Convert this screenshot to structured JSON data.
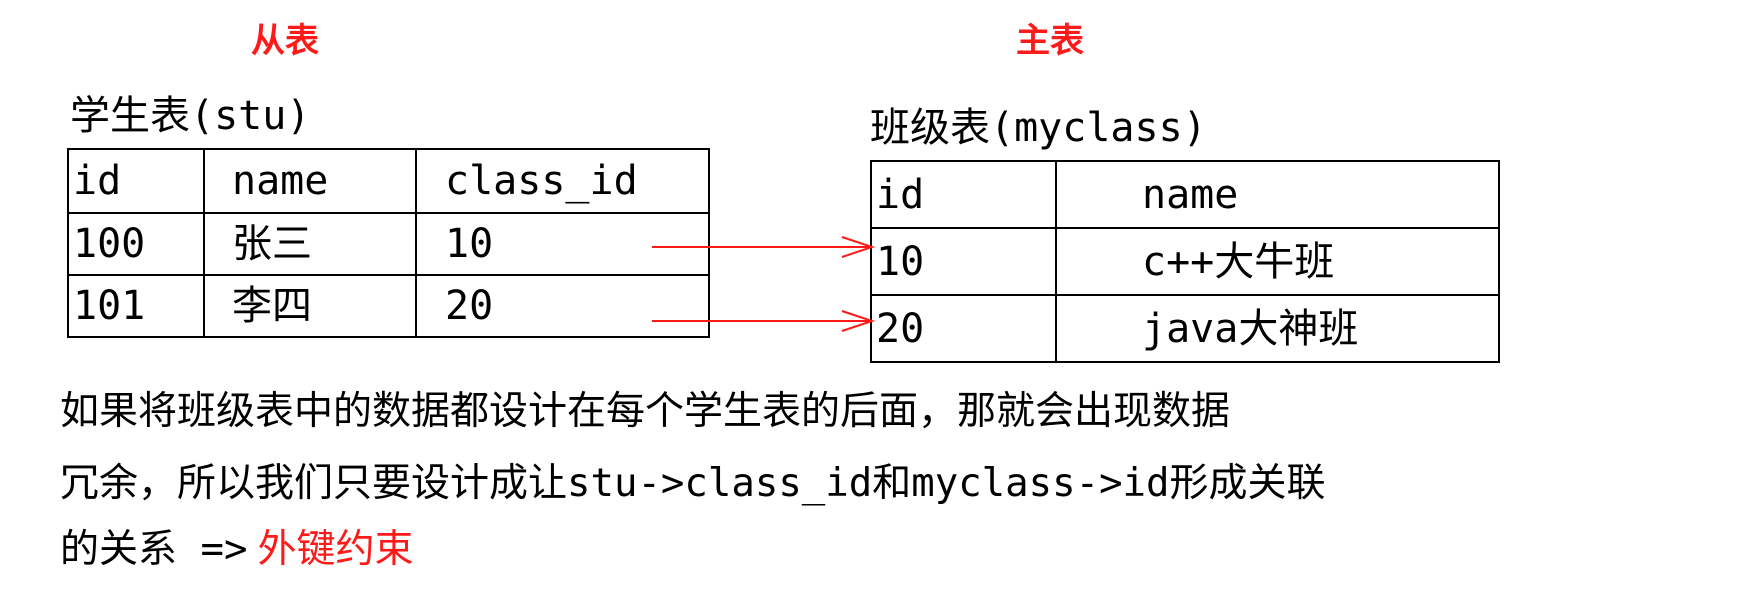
{
  "labels": {
    "child_table_role": "从表",
    "main_table_role": "主表"
  },
  "stu_table": {
    "caption": "学生表(stu)",
    "headers": [
      "id",
      "name",
      "class_id"
    ],
    "rows": [
      [
        "100",
        "张三",
        "10"
      ],
      [
        "101",
        "李四",
        "20"
      ]
    ]
  },
  "myclass_table": {
    "caption": "班级表(myclass)",
    "headers": [
      "id",
      "name"
    ],
    "rows": [
      [
        "10",
        "c++大牛班"
      ],
      [
        "20",
        "java大神班"
      ]
    ]
  },
  "arrow_color": "#ff1a1a",
  "highlight_color": "#ff1a1a",
  "note": {
    "line1": "如果将班级表中的数据都设计在每个学生表的后面，那就会出现数据",
    "line2": "冗余，所以我们只要设计成让stu->class_id和myclass->id形成关联",
    "line3_prefix": "的关系 =>",
    "line3_highlight": "外键约束"
  }
}
